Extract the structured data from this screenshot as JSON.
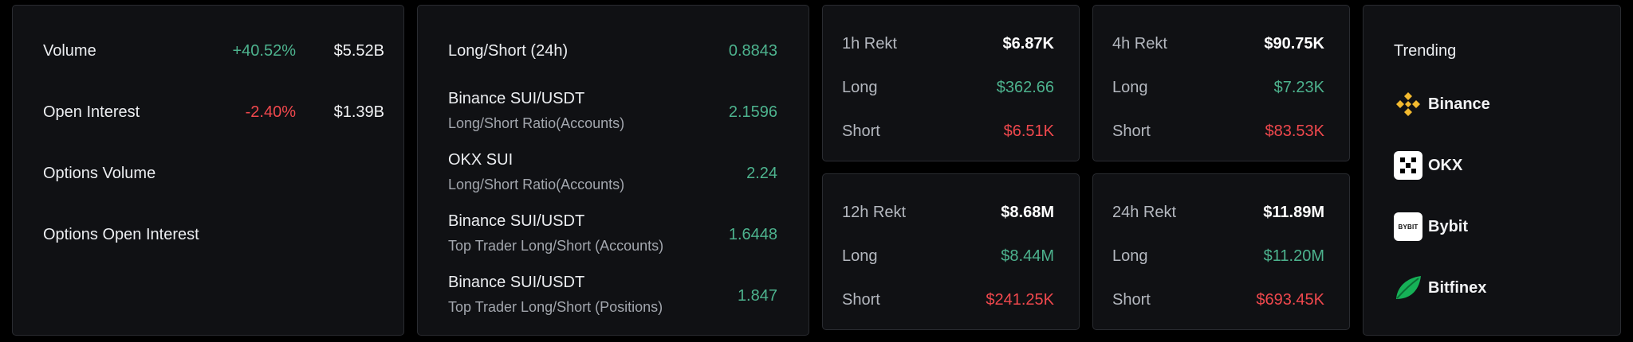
{
  "market": {
    "volume": {
      "label": "Volume",
      "change": "+40.52%",
      "value": "$5.52B"
    },
    "open_interest": {
      "label": "Open Interest",
      "change": "-2.40%",
      "value": "$1.39B"
    },
    "options_volume": {
      "label": "Options Volume"
    },
    "options_open_interest": {
      "label": "Options Open Interest"
    }
  },
  "ratios": {
    "header": {
      "label": "Long/Short (24h)",
      "value": "0.8843"
    },
    "items": [
      {
        "title": "Binance SUI/USDT",
        "subtitle": "Long/Short Ratio(Accounts)",
        "value": "2.1596"
      },
      {
        "title": "OKX SUI",
        "subtitle": "Long/Short Ratio(Accounts)",
        "value": "2.24"
      },
      {
        "title": "Binance SUI/USDT",
        "subtitle": "Top Trader Long/Short (Accounts)",
        "value": "1.6448"
      },
      {
        "title": "Binance SUI/USDT",
        "subtitle": "Top Trader Long/Short (Positions)",
        "value": "1.847"
      }
    ]
  },
  "rekt": {
    "h1": {
      "label": "1h Rekt",
      "total": "$6.87K",
      "long_label": "Long",
      "long": "$362.66",
      "short_label": "Short",
      "short": "$6.51K"
    },
    "h4": {
      "label": "4h Rekt",
      "total": "$90.75K",
      "long_label": "Long",
      "long": "$7.23K",
      "short_label": "Short",
      "short": "$83.53K"
    },
    "h12": {
      "label": "12h Rekt",
      "total": "$8.68M",
      "long_label": "Long",
      "long": "$8.44M",
      "short_label": "Short",
      "short": "$241.25K"
    },
    "h24": {
      "label": "24h Rekt",
      "total": "$11.89M",
      "long_label": "Long",
      "long": "$11.20M",
      "short_label": "Short",
      "short": "$693.45K"
    }
  },
  "trending": {
    "title": "Trending",
    "items": [
      {
        "name": "Binance",
        "icon": "binance-logo-icon"
      },
      {
        "name": "OKX",
        "icon": "okx-logo-icon"
      },
      {
        "name": "Bybit",
        "icon": "bybit-logo-icon",
        "logo_text": "BYBIT"
      },
      {
        "name": "Bitfinex",
        "icon": "bitfinex-logo-icon"
      }
    ]
  },
  "colors": {
    "green": "#4db38e",
    "red": "#f0484d",
    "binance": "#f3ba2f",
    "bitfinex": "#16b157"
  }
}
